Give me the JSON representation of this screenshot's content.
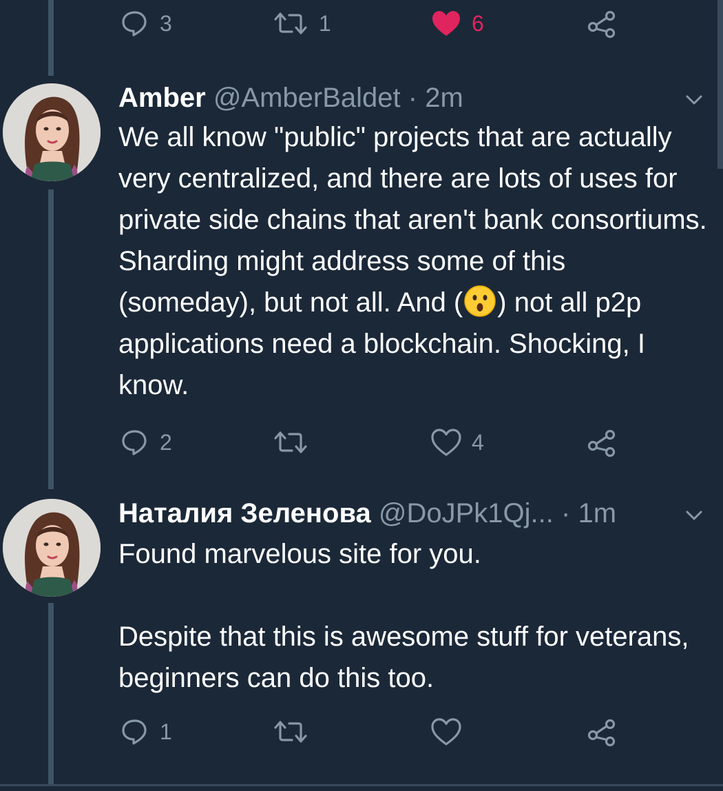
{
  "top_actions": {
    "reply_count": "3",
    "retweet_count": "1",
    "like_count": "6"
  },
  "tweets": [
    {
      "name": "Amber",
      "handle": "@AmberBaldet",
      "separator": "·",
      "time": "2m",
      "text_before_emoji": "We all know \"public\" projects that are actually very centralized, and there are lots of uses for private side chains that aren't bank consortiums. Sharding might address some of this (someday), but not all. And (",
      "text_after_emoji": ") not all p2p applications need a blockchain. Shocking, I know.",
      "reply_count": "2",
      "retweet_count": "",
      "like_count": "4"
    },
    {
      "name": "Наталия Зеленова",
      "handle": "@DoJPk1Qj...",
      "separator": "·",
      "time": "1m",
      "line1": "Found marvelous site for you.",
      "line2": "Despite that this is awesome stuff for veterans, beginners can do this too.",
      "reply_count": "1",
      "retweet_count": "",
      "like_count": ""
    }
  ],
  "colors": {
    "background": "#1b2838",
    "secondary_text": "#8899a6",
    "like_active": "#e0245e",
    "thread_line": "#3d5466"
  },
  "icons": [
    "reply-icon",
    "retweet-icon",
    "like-icon",
    "share-icon",
    "chevron-down-icon",
    "astonished-emoji"
  ]
}
